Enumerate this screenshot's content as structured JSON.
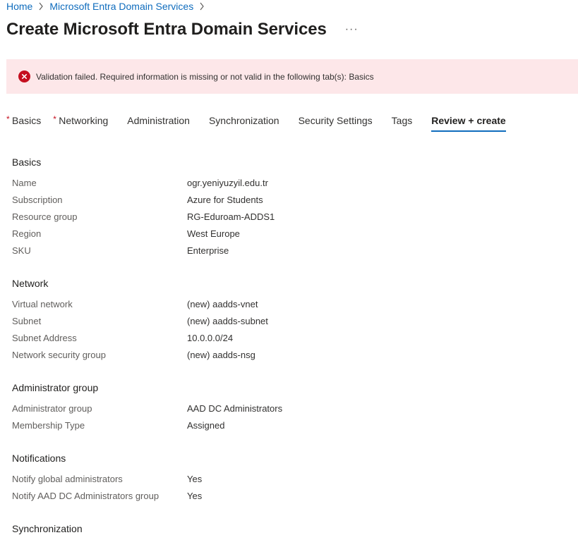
{
  "breadcrumb": {
    "home": "Home",
    "parent": "Microsoft Entra Domain Services"
  },
  "page": {
    "title": "Create Microsoft Entra Domain Services",
    "more_label": "···"
  },
  "alert": {
    "message": "Validation failed. Required information is missing or not valid in the following tab(s): Basics",
    "color": "#c50f1f"
  },
  "tabs": [
    {
      "label": "Basics",
      "required_mark": "*"
    },
    {
      "label": "Networking",
      "required_mark": "*"
    },
    {
      "label": "Administration"
    },
    {
      "label": "Synchronization"
    },
    {
      "label": "Security Settings"
    },
    {
      "label": "Tags"
    },
    {
      "label": "Review + create",
      "active": true
    }
  ],
  "sections": [
    {
      "title": "Basics",
      "rows": [
        {
          "key": "Name",
          "value": "ogr.yeniyuzyil.edu.tr"
        },
        {
          "key": "Subscription",
          "value": "Azure for Students"
        },
        {
          "key": "Resource group",
          "value": "RG-Eduroam-ADDS1"
        },
        {
          "key": "Region",
          "value": "West Europe"
        },
        {
          "key": "SKU",
          "value": "Enterprise"
        }
      ]
    },
    {
      "title": "Network",
      "rows": [
        {
          "key": "Virtual network",
          "value": "(new) aadds-vnet"
        },
        {
          "key": "Subnet",
          "value": "(new) aadds-subnet"
        },
        {
          "key": "Subnet Address",
          "value": "10.0.0.0/24"
        },
        {
          "key": "Network security group",
          "value": "(new) aadds-nsg"
        }
      ]
    },
    {
      "title": "Administrator group",
      "rows": [
        {
          "key": "Administrator group",
          "value": "AAD DC Administrators"
        },
        {
          "key": "Membership Type",
          "value": "Assigned"
        }
      ]
    },
    {
      "title": "Notifications",
      "rows": [
        {
          "key": "Notify global administrators",
          "value": "Yes"
        },
        {
          "key": "Notify AAD DC Administrators group",
          "value": "Yes"
        }
      ]
    },
    {
      "title": "Synchronization",
      "rows": []
    }
  ]
}
